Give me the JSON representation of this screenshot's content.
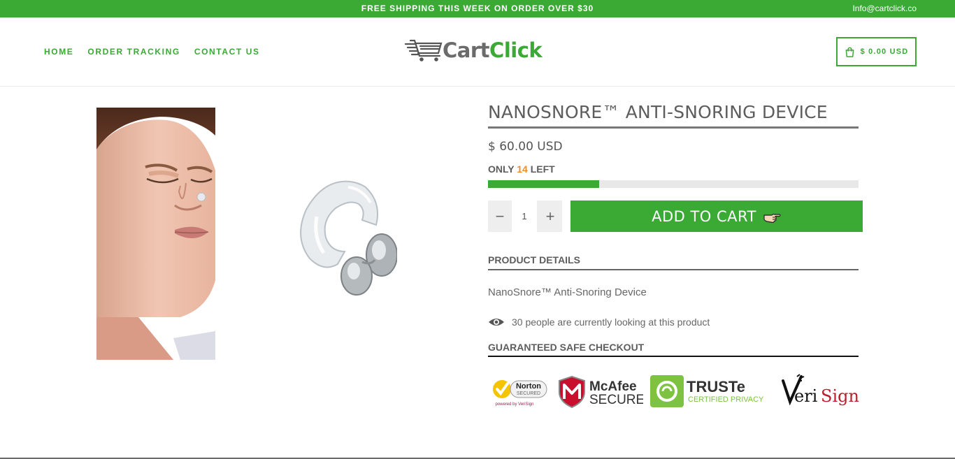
{
  "topbar": {
    "promo": "FREE SHIPPING THIS WEEK ON ORDER OVER $30",
    "email": "Info@cartclick.co"
  },
  "nav": {
    "items": [
      "HOME",
      "ORDER TRACKING",
      "CONTACT US"
    ]
  },
  "logo": {
    "part1": "Cart",
    "part2": "Click"
  },
  "cart": {
    "label": "$ 0.00 USD",
    "icon": "shopping-bag-icon"
  },
  "product": {
    "title": "NANOSNORE™ ANTI-SNORING DEVICE",
    "price": "$ 60.00 USD",
    "stock_prefix": "ONLY",
    "stock_count": "14",
    "stock_suffix": "LEFT",
    "stock_fraction": 0.3,
    "quantity": "1",
    "add_to_cart": "ADD TO CART",
    "details_heading": "PRODUCT DETAILS",
    "details_text": "NanoSnore™ Anti-Snoring Device",
    "viewers_text": "30 people are currently looking at this product",
    "checkout_heading": "GUARANTEED SAFE CHECKOUT"
  },
  "badges": {
    "norton": {
      "name": "Norton",
      "sub": "SECURED",
      "powered": "powered by VeriSign"
    },
    "mcafee": {
      "name": "McAfee",
      "sub": "SECURE"
    },
    "truste": {
      "name": "TRUSTe",
      "sub": "CERTIFIED PRIVACY"
    },
    "verisign": {
      "name": "VeriSign"
    }
  },
  "colors": {
    "accent": "#3aaa35",
    "stock_count": "#f08d2b"
  }
}
